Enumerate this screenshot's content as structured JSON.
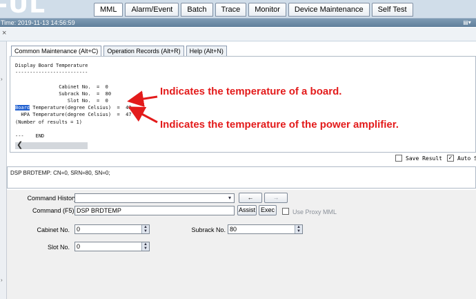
{
  "app": {
    "logo_text": "-UL"
  },
  "main_tabs": [
    {
      "label": "MML",
      "active": true
    },
    {
      "label": "Alarm/Event"
    },
    {
      "label": "Batch"
    },
    {
      "label": "Trace"
    },
    {
      "label": "Monitor"
    },
    {
      "label": "Device Maintenance"
    },
    {
      "label": "Self Test"
    }
  ],
  "timebar": {
    "text": "Time: 2019-11-13 14:56:59"
  },
  "icons": {
    "close": "close-icon",
    "print": "print-icon",
    "collapse": "chevron-icon",
    "scroll_left": "arrow-left-icon",
    "dropdown": "chevron-down-icon",
    "spinner": "spinner-icon",
    "back": "arrow-left-icon",
    "forward": "arrow-right-icon"
  },
  "sub_tabs": [
    {
      "label": "Common Maintenance (Alt+C)",
      "active": true
    },
    {
      "label": "Operation Records (Alt+R)"
    },
    {
      "label": "Help (Alt+N)"
    }
  ],
  "output": {
    "title": "Display Board Temperature",
    "underline": "-------------------------",
    "cabinet": "               Cabinet No.  =  0",
    "subrack": "               Subrack No.  =  80",
    "slot": "                  Slot No.  =  0",
    "board_word": "Board",
    "board_rest": " Temperature(degree Celsius)  =  43",
    "hpa": "  HPA Temperature(degree Celsius)  =  47",
    "count": "(Number of results = 1)",
    "end": "---    END"
  },
  "options": {
    "save_result": {
      "label": "Save Result",
      "checked": false
    },
    "auto_scroll": {
      "label": "Auto Sc",
      "checked": true
    }
  },
  "command_line": {
    "text": "DSP BRDTEMP: CN=0, SRN=80, SN=0;"
  },
  "form": {
    "history_label": "Command History:",
    "history_value": "",
    "back_label": "←",
    "forward_label": "→",
    "command_label": "Command (F5):",
    "command_value": "DSP BRDTEMP",
    "assist_label": "Assist",
    "exec_label": "Exec",
    "proxy_label": "Use Proxy MML",
    "cabinet_label": "Cabinet No.",
    "cabinet_value": "0",
    "subrack_label": "Subrack No.",
    "subrack_value": "80",
    "slot_label": "Slot No.",
    "slot_value": "0"
  },
  "annotations": {
    "board": "Indicates the temperature of a board.",
    "hpa": "Indicates the temperature of the power amplifier.",
    "color": "#e31b1b"
  }
}
